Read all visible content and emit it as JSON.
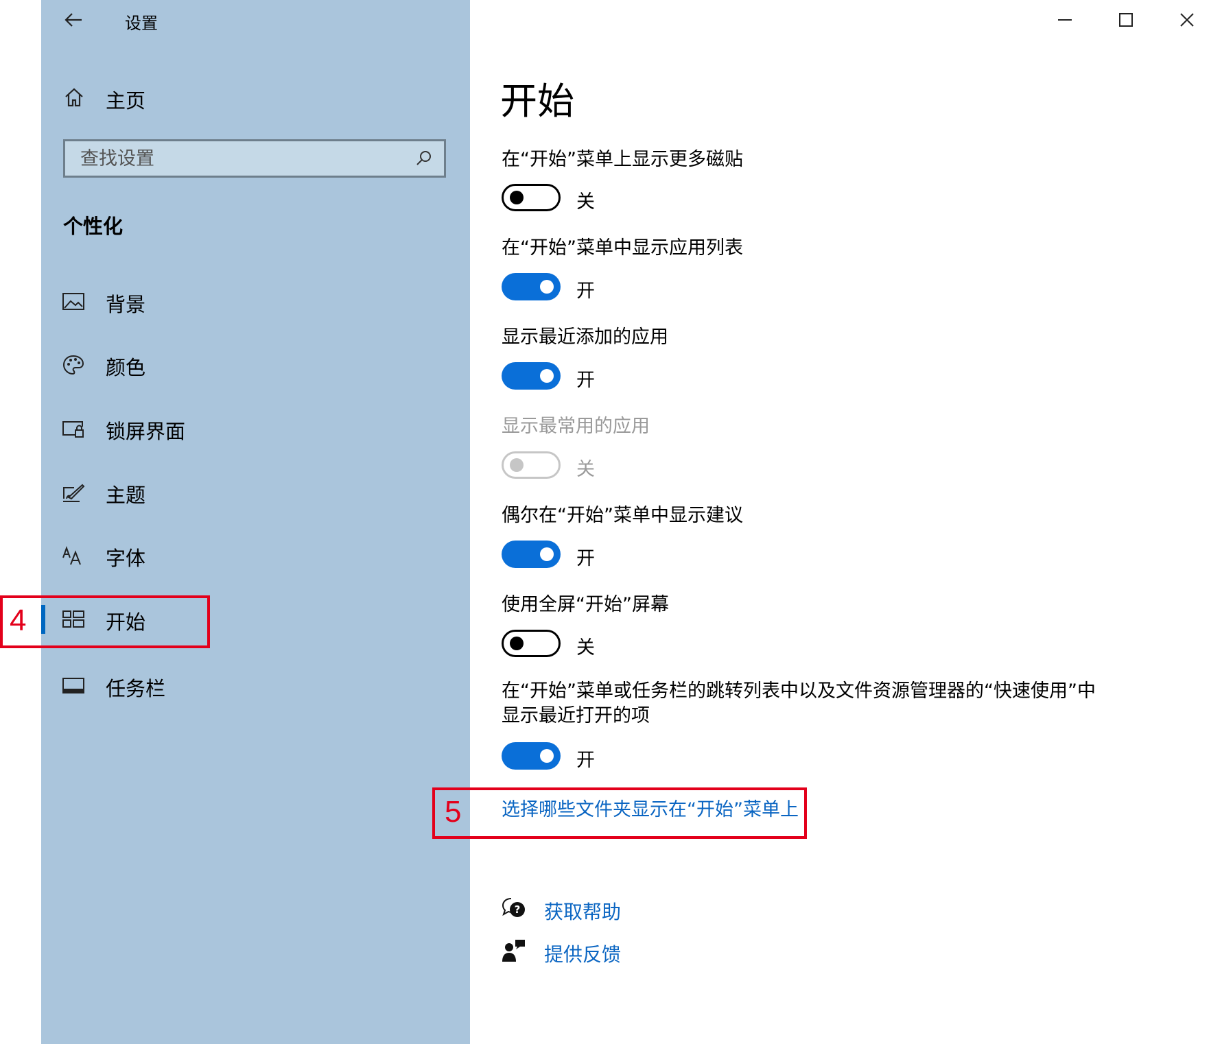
{
  "window": {
    "back_icon": "back-arrow-icon",
    "title": "设置",
    "controls": [
      "minimize-icon",
      "maximize-icon",
      "close-icon"
    ]
  },
  "sidebar": {
    "home_label": "主页",
    "search_placeholder": "查找设置",
    "section_title": "个性化",
    "items": [
      {
        "label": "背景",
        "icon": "picture-icon"
      },
      {
        "label": "颜色",
        "icon": "palette-icon"
      },
      {
        "label": "锁屏界面",
        "icon": "lock-screen-icon"
      },
      {
        "label": "主题",
        "icon": "theme-brush-icon"
      },
      {
        "label": "字体",
        "icon": "font-icon"
      },
      {
        "label": "开始",
        "icon": "start-grid-icon",
        "selected": true
      },
      {
        "label": "任务栏",
        "icon": "taskbar-icon"
      }
    ]
  },
  "main": {
    "page_title": "开始",
    "settings": [
      {
        "label": "在“开始”菜单上显示更多磁贴",
        "state": "关",
        "on": false,
        "disabled": false
      },
      {
        "label": "在“开始”菜单中显示应用列表",
        "state": "开",
        "on": true,
        "disabled": false
      },
      {
        "label": "显示最近添加的应用",
        "state": "开",
        "on": true,
        "disabled": false
      },
      {
        "label": "显示最常用的应用",
        "state": "关",
        "on": false,
        "disabled": true
      },
      {
        "label": "偶尔在“开始”菜单中显示建议",
        "state": "开",
        "on": true,
        "disabled": false
      },
      {
        "label": "使用全屏“开始”屏幕",
        "state": "关",
        "on": false,
        "disabled": false
      },
      {
        "label_line1": "在“开始”菜单或任务栏的跳转列表中以及文件资源管理器的“快速使用”中",
        "label_line2": "显示最近打开的项",
        "state": "开",
        "on": true,
        "disabled": false
      }
    ],
    "folders_link": "选择哪些文件夹显示在“开始”菜单上",
    "help_link": "获取帮助",
    "feedback_link": "提供反馈"
  },
  "annotations": {
    "step4": "4",
    "step5": "5",
    "color": "#e3001b"
  },
  "colors": {
    "sidebar_bg": "#aac5dc",
    "accent": "#0a6fd8",
    "link": "#0a65c2"
  }
}
